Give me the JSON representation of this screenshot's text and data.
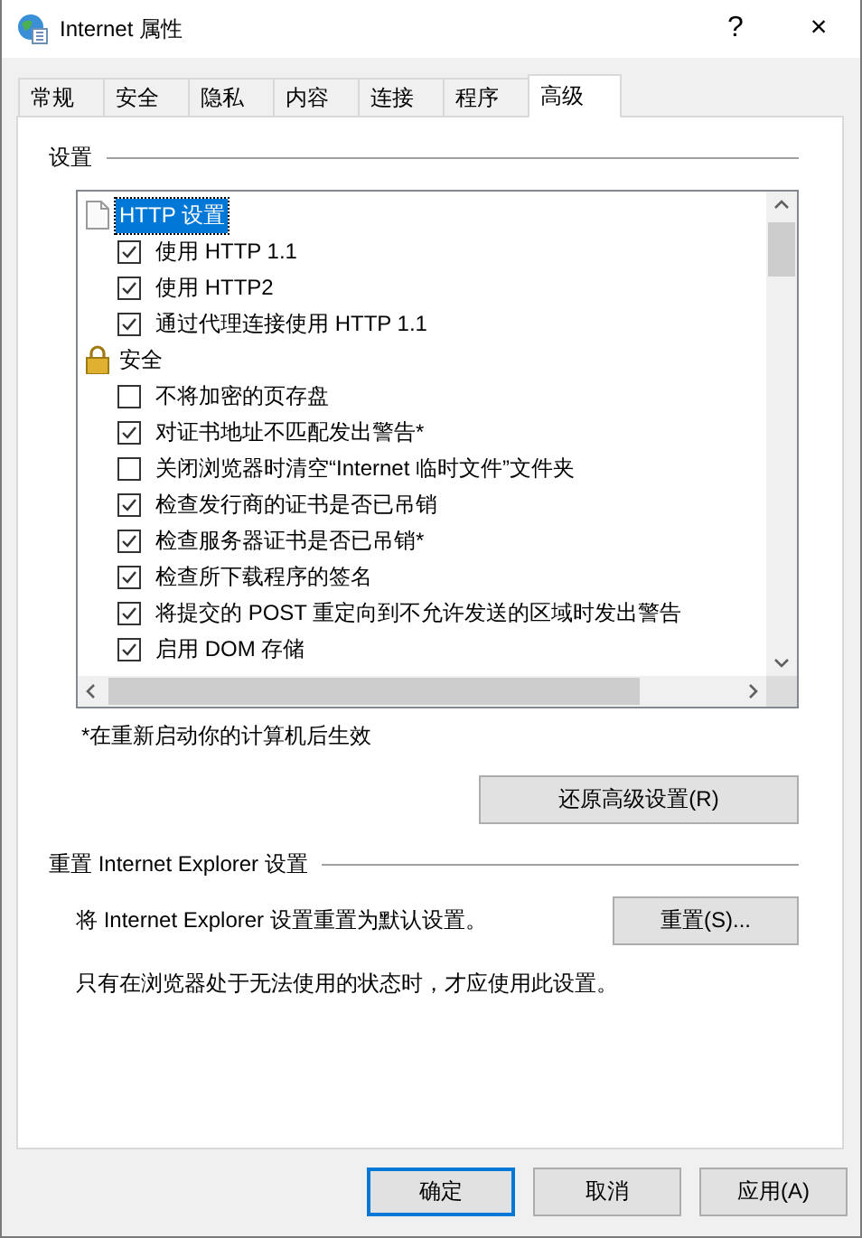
{
  "window": {
    "title": "Internet 属性",
    "help": "?",
    "close": "×"
  },
  "tabs": [
    {
      "label": "常规",
      "selected": false
    },
    {
      "label": "安全",
      "selected": false
    },
    {
      "label": "隐私",
      "selected": false
    },
    {
      "label": "内容",
      "selected": false
    },
    {
      "label": "连接",
      "selected": false
    },
    {
      "label": "程序",
      "selected": false
    },
    {
      "label": "高级",
      "selected": true
    }
  ],
  "settings": {
    "title": "设置",
    "tree": [
      {
        "label": "HTTP 设置",
        "selected": true,
        "children": [
          {
            "label": "使用 HTTP 1.1",
            "checked": true
          },
          {
            "label": "使用 HTTP2",
            "checked": true
          },
          {
            "label": "通过代理连接使用 HTTP 1.1",
            "checked": true
          }
        ]
      },
      {
        "label": "安全",
        "selected": false,
        "children": [
          {
            "label": "不将加密的页存盘",
            "checked": false
          },
          {
            "label": "对证书地址不匹配发出警告*",
            "checked": true
          },
          {
            "label": "关闭浏览器时清空“Internet 临时文件”文件夹",
            "checked": false
          },
          {
            "label": "检查发行商的证书是否已吊销",
            "checked": true
          },
          {
            "label": "检查服务器证书是否已吊销*",
            "checked": true
          },
          {
            "label": "检查所下载程序的签名",
            "checked": true
          },
          {
            "label": "将提交的 POST 重定向到不允许发送的区域时发出警告",
            "checked": true
          },
          {
            "label": "启用 DOM 存储",
            "checked": true
          }
        ]
      }
    ],
    "footnote": "*在重新启动你的计算机后生效",
    "restore_button": "还原高级设置(R)"
  },
  "reset": {
    "title": "重置 Internet Explorer 设置",
    "description": "将 Internet Explorer 设置重置为默认设置。",
    "button": "重置(S)...",
    "note": "只有在浏览器处于无法使用的状态时，才应使用此设置。"
  },
  "buttons": [
    {
      "label": "确定",
      "default": true
    },
    {
      "label": "取消",
      "default": false
    },
    {
      "label": "应用(A)",
      "default": false
    }
  ]
}
